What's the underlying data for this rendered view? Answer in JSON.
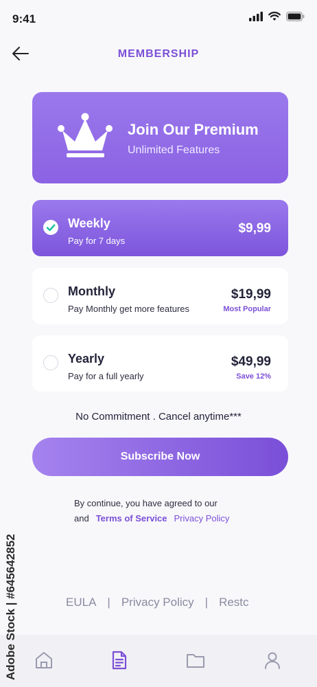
{
  "status_bar": {
    "time": "9:41"
  },
  "header": {
    "title": "MEMBERSHIP"
  },
  "banner": {
    "title": "Join Our Premium",
    "subtitle": "Unlimited Features"
  },
  "plans": [
    {
      "name": "Weekly",
      "description": "Pay for 7 days",
      "price": "$9,99",
      "badge": "",
      "selected": true
    },
    {
      "name": "Monthly",
      "description": "Pay Monthly get more features",
      "price": "$19,99",
      "badge": "Most Popular",
      "selected": false
    },
    {
      "name": "Yearly",
      "description": "Pay for a full yearly",
      "price": "$49,99",
      "badge": "Save 12%",
      "selected": false
    }
  ],
  "no_commitment": "No Commitment . Cancel anytime***",
  "subscribe_label": "Subscribe Now",
  "legal": {
    "line1": "By continue, you have agreed to our",
    "and": "and",
    "terms": "Terms of Service",
    "privacy": "Privacy Policy"
  },
  "footer": {
    "eula": "EULA",
    "privacy": "Privacy Policy",
    "restore": "Restc",
    "separator": "|"
  },
  "tabs": [
    "home-icon",
    "document-icon",
    "folder-icon",
    "profile-icon"
  ],
  "colors": {
    "accent": "#7b4fd6",
    "banner": "#9a79ec",
    "check": "#20c2a3"
  },
  "watermark": "Adobe Stock | #645642852"
}
